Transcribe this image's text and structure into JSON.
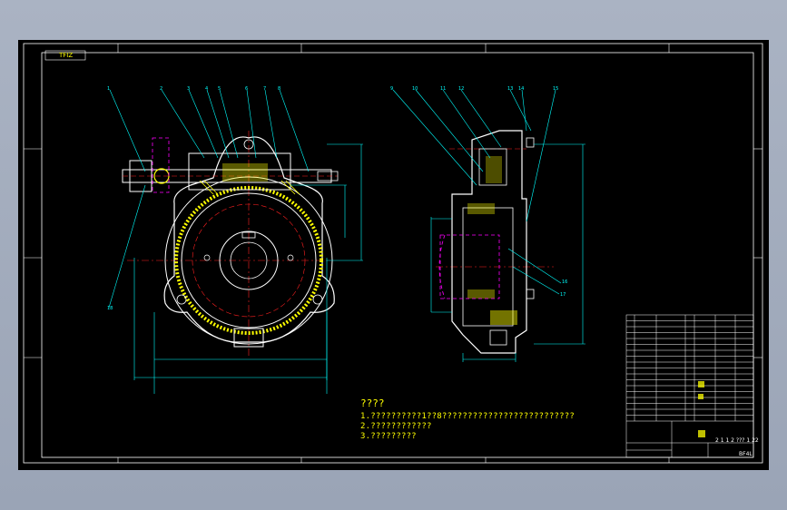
{
  "drawing": {
    "sheet_tag": "TFIZ",
    "notes": {
      "title": "????",
      "lines": [
        "1.??????????1??8??????????????????????????",
        "2.????????????",
        "3.?????????"
      ]
    },
    "title_block": {
      "code": "2 1 1 2 ??? 1 22",
      "name": "BF4L"
    },
    "colors": {
      "background": "#000000",
      "border": "#ffffff",
      "outline": "#ffffff",
      "centerline": "#ff2020",
      "dimension": "#00ffff",
      "hatch": "#ffff00",
      "hidden": "#ff00ff",
      "frame_outer": "#a9b2c2"
    }
  }
}
